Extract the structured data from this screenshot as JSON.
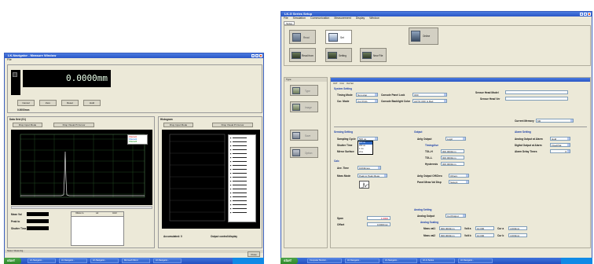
{
  "left_window": {
    "title": "LK-Navigator - Measure Window",
    "menu": [
      "File"
    ],
    "readout_value": "0.0000mm",
    "judgement": "0.0000mm",
    "buttons": [
      "Cancel",
      "Zero",
      "Reset",
      "Hold"
    ],
    "left_graph": {
      "title": "Data Grid (01)",
      "button_a": "Drop Input Mode",
      "button_b": "Drop Visual Pi Cursor",
      "legend": [
        "Channel1",
        "Channel2",
        "Channel3"
      ]
    },
    "right_graph": {
      "title": "Histogram",
      "button_a": "Drop Input Mode",
      "button_b": "Drop Visual Pi Cursor"
    },
    "stats": {
      "labels": [
        "Mean Val",
        "Peak to",
        "Shutter Time"
      ],
      "table_headers": [
        "#data no.",
        "val",
        "Hold"
      ],
      "footer_a": "Accumulated: 0",
      "footer_b": "Output control/display"
    },
    "status_bar": "Status: Measuring...",
    "close_button": "Close"
  },
  "right_window": {
    "title": "LK-G Series Setup",
    "menu": [
      "File",
      "Simulation",
      "Communication",
      "Measurement",
      "Display",
      "Window"
    ],
    "toolbar_tab": "Setup",
    "toolbar_buttons": [
      {
        "label": "Read",
        "icon": "monitor-icon"
      },
      {
        "label": "Set",
        "icon": "panel-icon"
      },
      {
        "label": "Online",
        "icon": "controller-icon"
      },
      {
        "label": "Read from",
        "icon": "device-icon"
      },
      {
        "label": "Setting",
        "icon": "settings-icon"
      },
      {
        "label": "New File",
        "icon": "file-icon"
      }
    ],
    "side_title": "Type",
    "side_items": [
      "Type",
      "Image",
      "Save",
      "Option"
    ],
    "sub_tabs": [
      "OUT",
      "Cmn",
      "Out Set"
    ],
    "system_setting": {
      "section": "System Setting",
      "timing_mode_label": "Timing Mode",
      "timing_mode_value": "Non-stop",
      "cur_mode_label": "Cur. Mode",
      "cur_mode_value": "Cur FULL",
      "panel_lock_label": "Console Panel Lock",
      "panel_lock_value": "OFF",
      "backlight_label": "Console Backlight Color",
      "backlight_value": "AUTO OFF & Red",
      "sensor_model_label": "Sensor Head Model",
      "sensor_ver_label": "Sensor Head Ver",
      "memory_label": "Current Memory",
      "memory_value": "M0"
    },
    "sensing_setting": {
      "section": "Sensing Setting",
      "sampling_label": "Sampling Cycle",
      "sampling_value": "500 us",
      "sampling_options": [
        "500 us",
        "200 us",
        "1 ms",
        "2ms"
      ],
      "shutter_label": "Shutter Time",
      "shutter_value": "Auto",
      "mirror_label": "Mirror Surface",
      "mirror_value": "Norm"
    },
    "calc": {
      "section": "Calc",
      "ave_label": "Ave. Time",
      "ave_value": "1024times",
      "meas_label": "Meas Mode",
      "meas_value": "Peak to Peak Meas"
    },
    "output": {
      "section": "Output",
      "analog_label": "Anlg Output",
      "analog_value": "Logic",
      "sub_section": "Timing/Ave",
      "tolh_label": "TOL-H",
      "tolh_value": "000.0000mm",
      "toll_label": "TOL-L",
      "toll_value": "000.0000mm",
      "hyst_label": "Hysteresis",
      "hyst_value": "000.0000mm",
      "analog_offset_label": "Anlg Output Off/Zero",
      "analog_offset_value": "Others",
      "panel_label": "Panel Meas Val Disp",
      "panel_value": "Setup1"
    },
    "alarm": {
      "section": "Alarm Setting",
      "analog_alarm_label": "Analog Output at Alarm",
      "analog_alarm_value": "Hold",
      "digital_alarm_label": "Digital Output at Alarm",
      "digital_alarm_value": "Fixed/Val",
      "delay_label": "Alarm Delay Times",
      "delay_value": "0"
    },
    "span": {
      "span_label": "Span",
      "span_value": "1.0000",
      "offset_label": "Offset",
      "offset_value": "0.0000mm"
    },
    "analog_setting": {
      "section": "Analog Setting",
      "output_label": "Analog Output",
      "output_value": "Cur/Output",
      "sub_section": "Analog Scaling",
      "row1_label": "Meas val1",
      "row1_value": "900.0000mm",
      "row1_b_label": "Volt a",
      "row1_b_value": "10.000",
      "row1_c_label": "Cur a",
      "row1_c_value": "4.000mA",
      "row2_label": "Meas val2",
      "row2_value": "900.0000mm",
      "row2_b_label": "Volt b",
      "row2_b_value": "10.000",
      "row2_c_label": "Cur b",
      "row2_c_value": "4.000mA"
    }
  },
  "taskbar_left": {
    "start": "start",
    "tasks": [
      "LK-Navigator...",
      "LK-Navigator...",
      "LK-Navigator...",
      "Microsoft Word",
      "LK-Navigator..."
    ]
  },
  "taskbar_right": {
    "start": "start",
    "tasks": [
      "Computer Monitor...",
      "LK-Navigator...",
      "LK-Navigator...",
      "LK-G Series",
      "LK-Navigator..."
    ]
  }
}
